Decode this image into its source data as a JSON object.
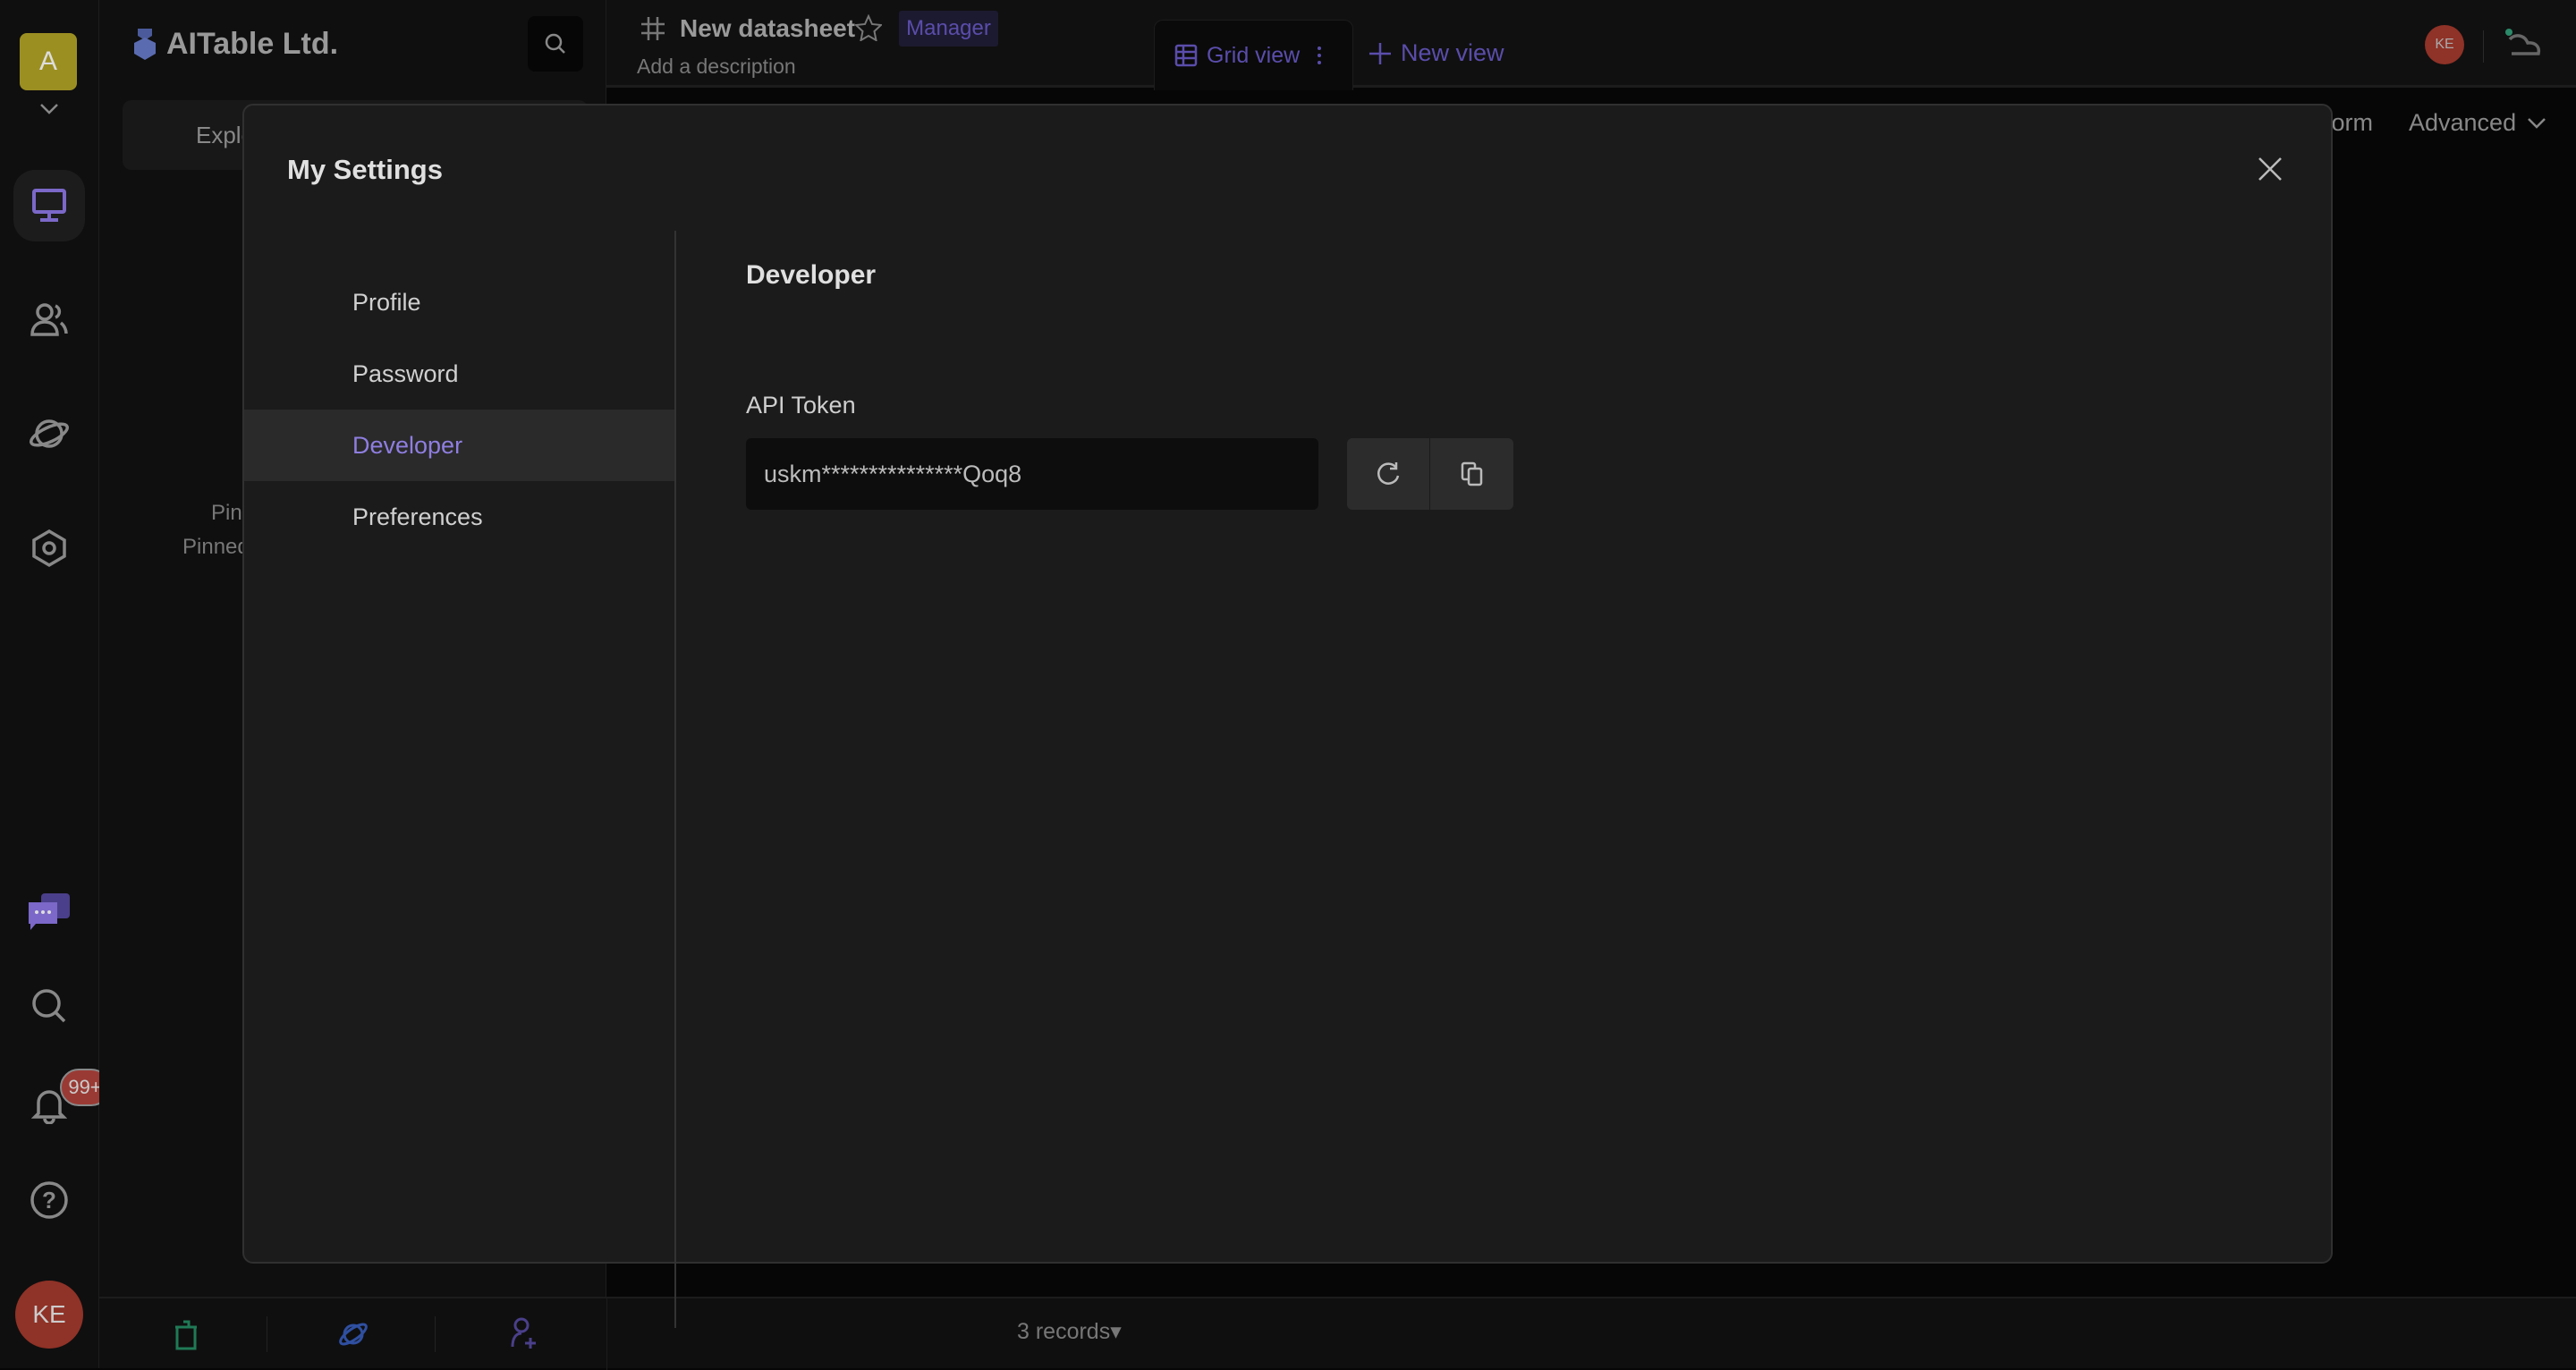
{
  "rail": {
    "space_initial": "A",
    "avatar_initials": "KE",
    "notification_badge": "99+",
    "accent": "#7b68c8"
  },
  "sidebar": {
    "workspace_name": "AITable Ltd.",
    "explore_label": "Explo",
    "pinned_partial_1": "Pin",
    "pinned_partial_2": "Pinned"
  },
  "header": {
    "datasheet_name": "New datasheet",
    "role_badge": "Manager",
    "description_placeholder": "Add a description",
    "tabs": [
      {
        "label": "Grid view"
      }
    ],
    "new_view_label": "New view",
    "collaborator_initials": "KE"
  },
  "toolbar": {
    "form_label": "Form",
    "advanced_label": "Advanced"
  },
  "footer": {
    "records_label": "3 records▾"
  },
  "modal": {
    "title": "My Settings",
    "nav": [
      {
        "label": "Profile"
      },
      {
        "label": "Password"
      },
      {
        "label": "Developer",
        "active": true
      },
      {
        "label": "Preferences"
      }
    ],
    "section_title": "Developer",
    "api_token_label": "API Token",
    "api_token_value": "uskm***************Qoq8"
  }
}
